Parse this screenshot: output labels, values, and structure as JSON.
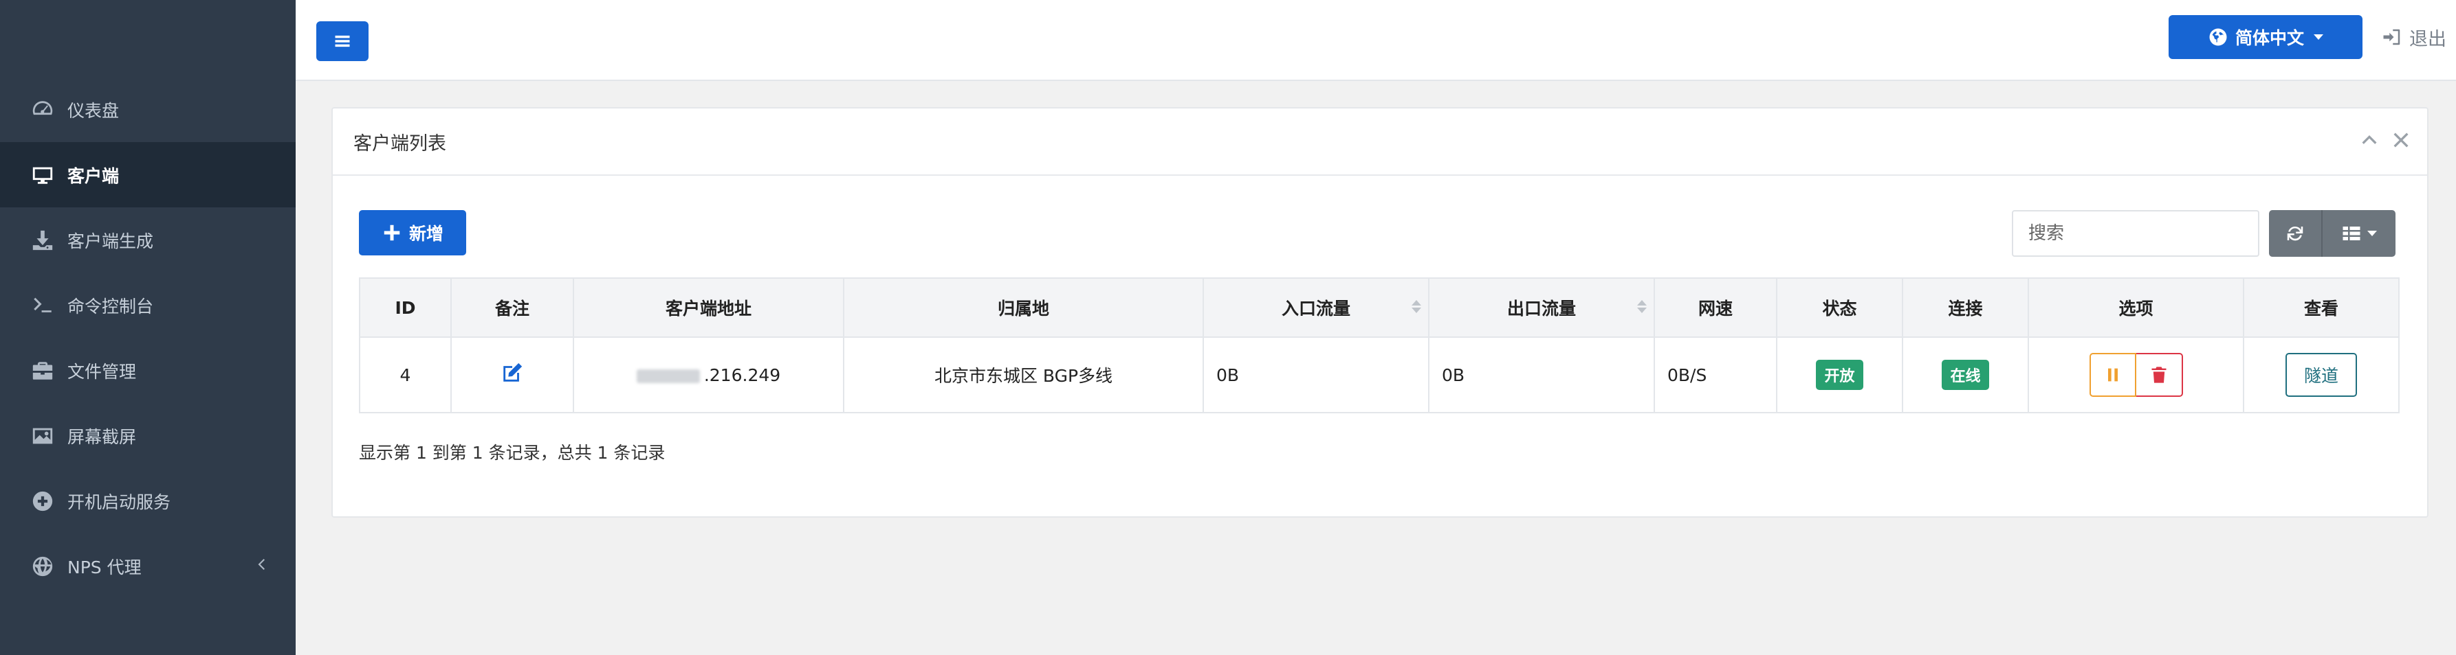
{
  "sidebar": {
    "items": [
      {
        "label": "仪表盘",
        "icon": "dashboard-icon"
      },
      {
        "label": "客户端",
        "icon": "monitor-icon",
        "active": true
      },
      {
        "label": "客户端生成",
        "icon": "download-icon"
      },
      {
        "label": "命令控制台",
        "icon": "terminal-icon"
      },
      {
        "label": "文件管理",
        "icon": "briefcase-icon"
      },
      {
        "label": "屏幕截屏",
        "icon": "image-icon"
      },
      {
        "label": "开机启动服务",
        "icon": "plus-circle-icon"
      },
      {
        "label": "NPS 代理",
        "icon": "globe-icon",
        "has_submenu": true
      }
    ]
  },
  "topbar": {
    "language_label": "简体中文",
    "logout_label": "退出"
  },
  "panel": {
    "title": "客户端列表",
    "add_label": "新增",
    "search_placeholder": "搜索",
    "columns": [
      "ID",
      "备注",
      "客户端地址",
      "归属地",
      "入口流量",
      "出口流量",
      "网速",
      "状态",
      "连接",
      "选项",
      "查看"
    ],
    "rows": [
      {
        "id": "4",
        "address": ".216.249",
        "location": "北京市东城区 BGP多线",
        "inbound": "0B",
        "outbound": "0B",
        "speed": "0B/S",
        "status": "开放",
        "connection": "在线",
        "view_label": "隧道"
      }
    ],
    "summary": "显示第 1 到第 1 条记录，总共 1 条记录"
  },
  "colors": {
    "primary": "#1765d3",
    "sidebar_bg": "#2f3b4a",
    "success": "#28a070",
    "warning": "#f0a030",
    "danger": "#dc3545"
  }
}
